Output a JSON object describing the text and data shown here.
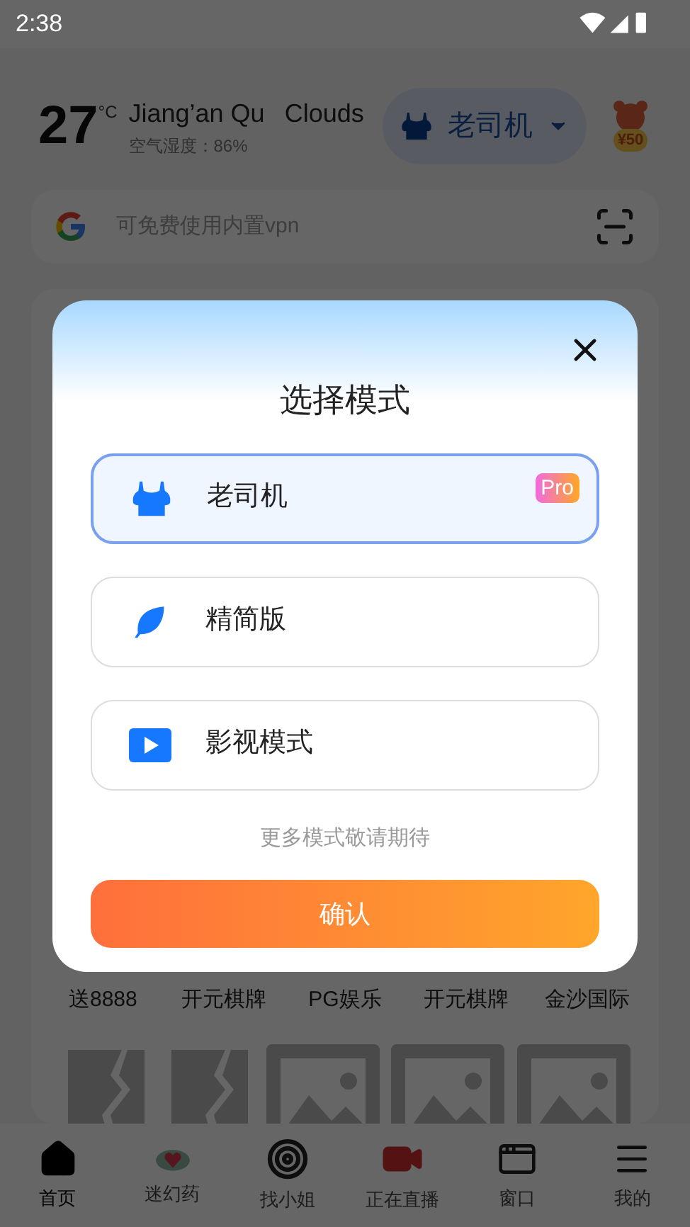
{
  "status_bar": {
    "time": "2:38"
  },
  "weather": {
    "temperature": "27",
    "unit": "°C",
    "location": "Jiang’an Qu",
    "condition": "Clouds",
    "humidity": "空气湿度：86%"
  },
  "mode_switch": {
    "label": "老司机"
  },
  "reward": {
    "amount": "¥50"
  },
  "search": {
    "placeholder": "可免费使用内置vpn"
  },
  "games": [
    {
      "label": "送8888"
    },
    {
      "label": "开元棋牌"
    },
    {
      "label": "PG娱乐"
    },
    {
      "label": "开元棋牌"
    },
    {
      "label": "金沙国际"
    }
  ],
  "thumbnails": [
    {
      "kind": "broken"
    },
    {
      "kind": "broken"
    },
    {
      "kind": "image"
    },
    {
      "kind": "image"
    },
    {
      "kind": "image"
    }
  ],
  "bottom_nav": [
    {
      "label": "首页",
      "kind": "home",
      "selected": true
    },
    {
      "label": "迷幻药",
      "kind": "heart",
      "selected": false
    },
    {
      "label": "找小姐",
      "kind": "target",
      "selected": false
    },
    {
      "label": "正在直播",
      "kind": "live",
      "selected": false
    },
    {
      "label": "窗口",
      "kind": "window",
      "selected": false
    },
    {
      "label": "我的",
      "kind": "menu",
      "selected": false
    }
  ],
  "dialog": {
    "title": "选择模式",
    "modes": [
      {
        "label": "老司机",
        "kind": "bra",
        "selected": true,
        "badge": "Pro"
      },
      {
        "label": "精简版",
        "kind": "leaf",
        "selected": false
      },
      {
        "label": "影视模式",
        "kind": "video",
        "selected": false
      }
    ],
    "note": "更多模式敬请期待",
    "confirm": "确认"
  }
}
